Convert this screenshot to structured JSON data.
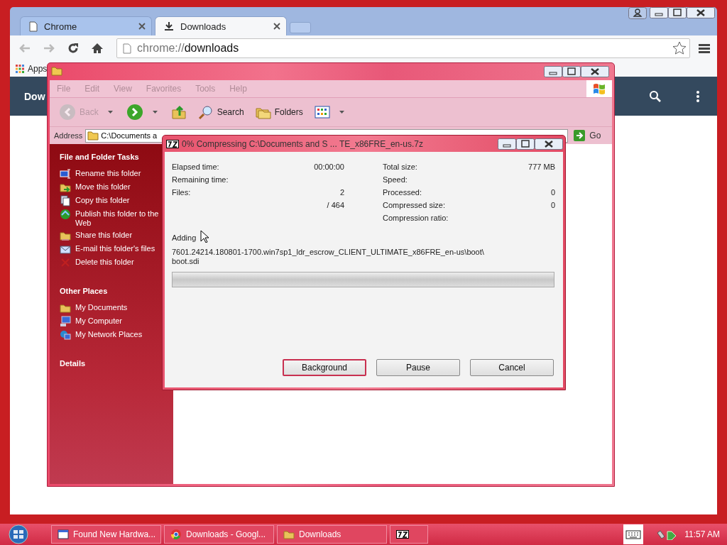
{
  "chrome": {
    "tabs": [
      {
        "title": "Chrome",
        "kind": "page",
        "selected": false
      },
      {
        "title": "Downloads",
        "kind": "download",
        "selected": true
      }
    ],
    "address": {
      "scheme": "chrome://",
      "path": "downloads"
    },
    "bookmarks": [
      "Apps"
    ],
    "page_header": {
      "title": "Dow"
    }
  },
  "explorer": {
    "menu": [
      "File",
      "Edit",
      "View",
      "Favorites",
      "Tools",
      "Help"
    ],
    "toolbar": [
      {
        "kind": "back",
        "label": "Back",
        "disabled": true,
        "dropdown": true
      },
      {
        "kind": "forward",
        "disabled": false,
        "dropdown": true
      },
      {
        "kind": "up",
        "disabled": false,
        "dropdown": false
      },
      {
        "kind": "search",
        "label": "Search",
        "disabled": false,
        "dropdown": false
      },
      {
        "kind": "folders",
        "label": "Folders",
        "disabled": false,
        "dropdown": false
      },
      {
        "kind": "views",
        "disabled": false,
        "dropdown": true
      }
    ],
    "address": {
      "label": "Address",
      "value": "C:\\Documents a",
      "go": "Go"
    },
    "sections": [
      {
        "title": "File and Folder Tasks",
        "items": [
          {
            "label": "Rename this folder",
            "kind": "rename"
          },
          {
            "label": "Move this folder",
            "kind": "move"
          },
          {
            "label": "Copy this folder",
            "kind": "copy"
          },
          {
            "label": "Publish this folder to the Web",
            "kind": "publish"
          },
          {
            "label": "Share this folder",
            "kind": "share"
          },
          {
            "label": "E-mail this folder's files",
            "kind": "email"
          },
          {
            "label": "Delete this folder",
            "kind": "delete"
          }
        ]
      },
      {
        "title": "Other Places",
        "items": [
          {
            "label": "My Documents",
            "kind": "folder"
          },
          {
            "label": "My Computer",
            "kind": "computer"
          },
          {
            "label": "My Network Places",
            "kind": "network"
          }
        ]
      },
      {
        "title": "Details"
      }
    ]
  },
  "dialog": {
    "title": "0% Compressing C:\\Documents and S ... TE_x86FRE_en-us.7z",
    "stats_left": [
      {
        "label": "Elapsed time:",
        "value": "00:00:00"
      },
      {
        "label": "Remaining time:"
      },
      {
        "label": "Files:",
        "value": "2"
      },
      {
        "value": "/ 464"
      }
    ],
    "stats_right": [
      {
        "label": "Total size:",
        "value": "777 MB"
      },
      {
        "label": "Speed:"
      },
      {
        "label": "Processed:",
        "value": "0"
      },
      {
        "label": "Compressed size:",
        "value": "0"
      },
      {
        "label": "Compression ratio:"
      }
    ],
    "operation": "Adding",
    "file": "7601.24214.180801-1700.win7sp1_ldr_escrow_CLIENT_ULTIMATE_x86FRE_en-us\\boot\\ boot.sdi",
    "progress": {
      "level": 0
    },
    "buttons": [
      {
        "label": "Background",
        "focused": true
      },
      {
        "label": "Pause",
        "focused": false
      },
      {
        "label": "Cancel",
        "focused": false
      }
    ]
  },
  "taskbar": {
    "items": [
      {
        "label": "Found New Hardwa...",
        "kind": "window"
      },
      {
        "label": "Downloads - Googl...",
        "kind": "chrome"
      },
      {
        "label": "Downloads",
        "kind": "folder"
      },
      {
        "kind": "sevenzip"
      }
    ],
    "clock": "11:57 AM"
  }
}
